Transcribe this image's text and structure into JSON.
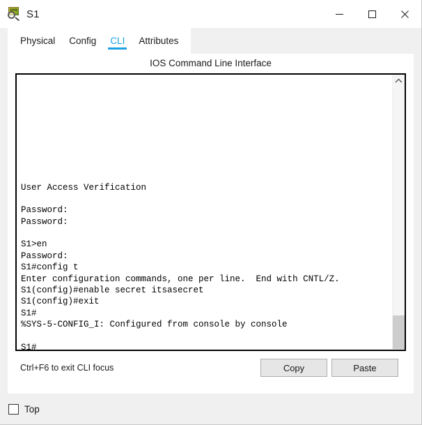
{
  "window": {
    "title": "S1",
    "icon": "switch-magnifier-icon",
    "controls": {
      "minimize": "minimize-icon",
      "maximize": "maximize-icon",
      "close": "close-icon"
    }
  },
  "tabs": [
    {
      "label": "Physical",
      "active": false
    },
    {
      "label": "Config",
      "active": false
    },
    {
      "label": "CLI",
      "active": true
    },
    {
      "label": "Attributes",
      "active": false
    }
  ],
  "panel": {
    "heading": "IOS Command Line Interface"
  },
  "terminal": {
    "lines": [
      "",
      "",
      "",
      "",
      "",
      "",
      "",
      "",
      "",
      "User Access Verification",
      "",
      "Password:",
      "Password:",
      "",
      "S1>en",
      "Password:",
      "S1#config t",
      "Enter configuration commands, one per line.  End with CNTL/Z.",
      "S1(config)#enable secret itsasecret",
      "S1(config)#exit",
      "S1#",
      "%SYS-5-CONFIG_I: Configured from console by console",
      "",
      "S1#"
    ]
  },
  "scrollbar": {
    "up_arrow": "chevron-up-icon",
    "down_arrow": "chevron-down-icon"
  },
  "bottom": {
    "hint": "Ctrl+F6 to exit CLI focus",
    "copy_label": "Copy",
    "paste_label": "Paste"
  },
  "footer": {
    "top_checkbox_label": "Top",
    "top_checked": false
  },
  "colors": {
    "accent": "#1ba1e2",
    "window_bg": "#f0f0f0",
    "panel_bg": "#ffffff",
    "terminal_text": "#000000",
    "button_bg": "#e6e6e6"
  }
}
